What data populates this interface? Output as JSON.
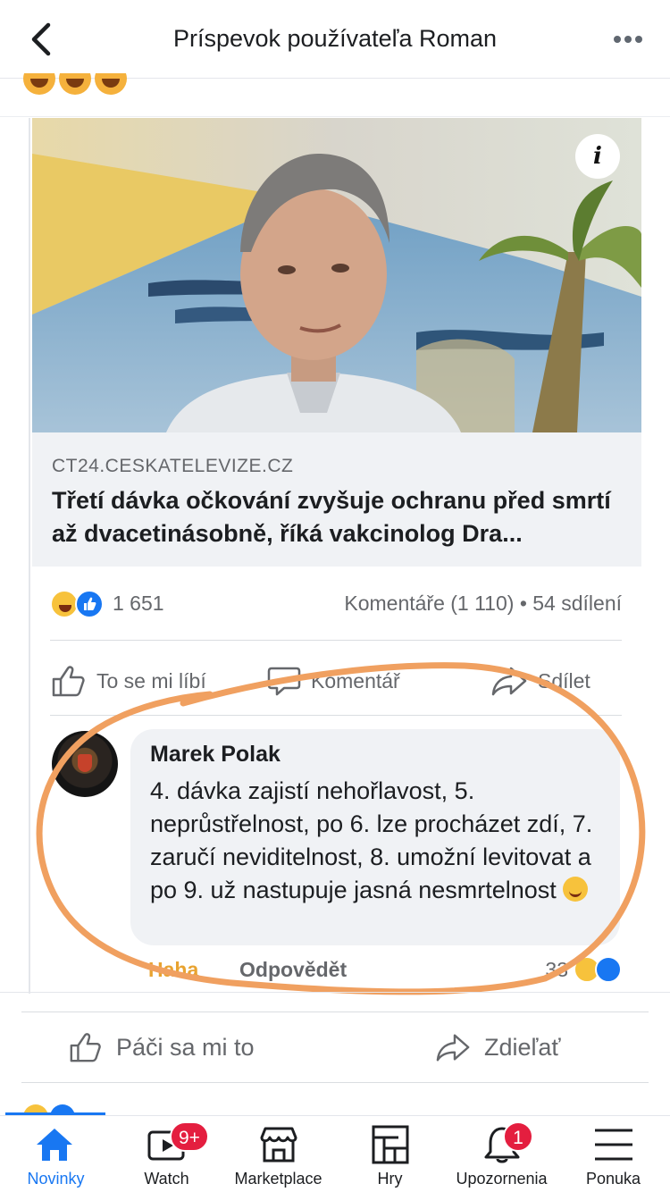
{
  "header": {
    "title": "Príspevok používateľa Roman"
  },
  "link_preview": {
    "domain": "CT24.CESKATELEVIZE.CZ",
    "title": "Třetí dávka očkování zvyšuje ochranu před smrtí až dvacetinásobně, říká vakcinolog Dra..."
  },
  "post_stats": {
    "reaction_count": "1 651",
    "comments_shares": "Komentáře (1 110) • 54 sdílení"
  },
  "inner_actions": {
    "like": "To se mi líbí",
    "comment": "Komentář",
    "share": "Sdílet"
  },
  "comment": {
    "author": "Marek Polak",
    "text": "4. dávka zajistí nehořlavost, 5. neprůstřelnost, po 6. lze procházet zdí, 7. zaručí neviditelnost, 8. umožní levitovat a po 9. už nastupuje jasná nesmrtelnost",
    "action_haha": "Haha",
    "action_reply": "Odpovědět",
    "reaction_count": "33"
  },
  "outer_actions": {
    "like": "Páči sa mi to",
    "share": "Zdieľať"
  },
  "tabbar": {
    "tabs": [
      {
        "label": "Novinky"
      },
      {
        "label": "Watch",
        "badge": "9+"
      },
      {
        "label": "Marketplace"
      },
      {
        "label": "Hry"
      },
      {
        "label": "Upozornenia",
        "badge": "1"
      },
      {
        "label": "Ponuka"
      }
    ]
  },
  "colors": {
    "accent": "#1877f2",
    "badge": "#e41e3f",
    "annotation": "#f0a060"
  }
}
